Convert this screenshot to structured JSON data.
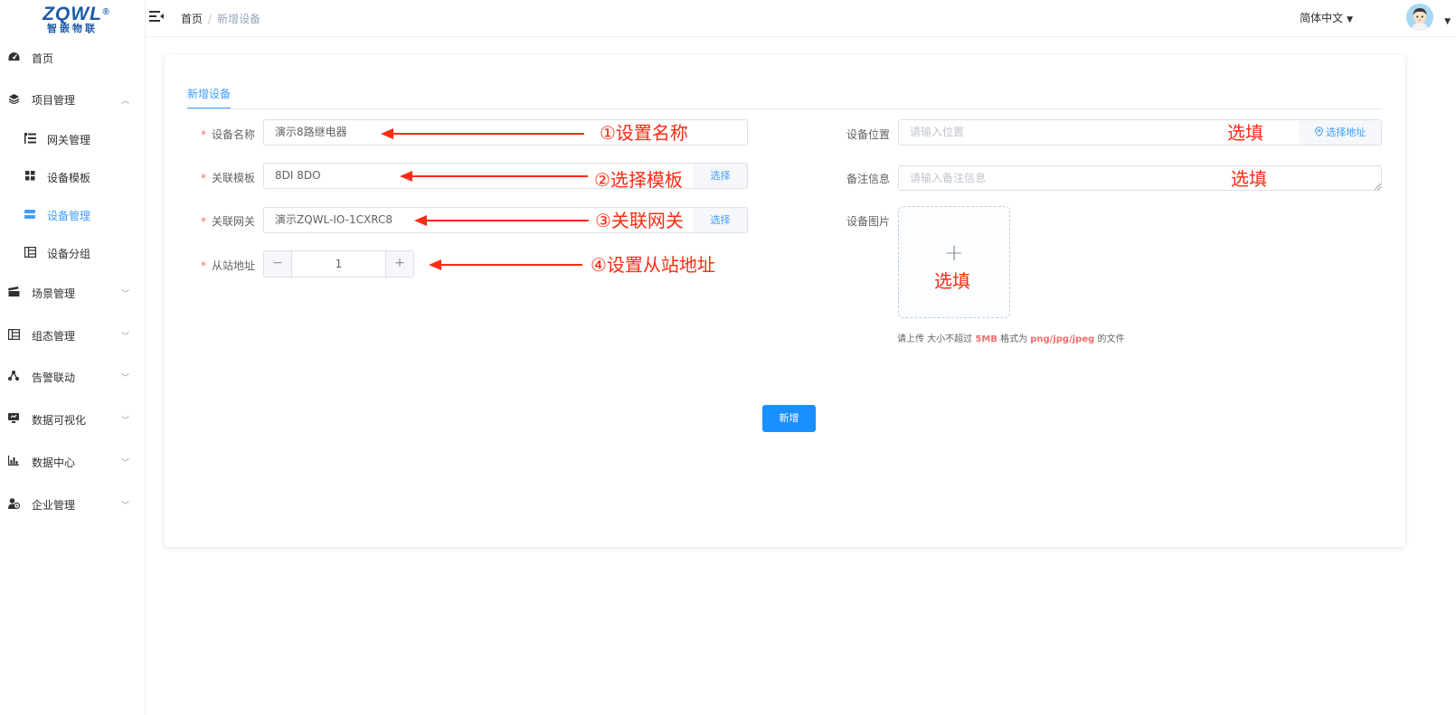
{
  "logo": {
    "top": "ZQWL",
    "reg": "®",
    "bottom": "智嵌物联"
  },
  "sidebar": {
    "items": [
      {
        "label": "首页",
        "icon": "dashboard-icon"
      },
      {
        "label": "项目管理",
        "icon": "layers-icon"
      },
      {
        "label": "网关管理",
        "icon": "tree-list-icon"
      },
      {
        "label": "设备模板",
        "icon": "grid-icon"
      },
      {
        "label": "设备管理",
        "icon": "server-icon"
      },
      {
        "label": "设备分组",
        "icon": "table-icon"
      },
      {
        "label": "场景管理",
        "icon": "clapper-icon"
      },
      {
        "label": "组态管理",
        "icon": "table-icon"
      },
      {
        "label": "告警联动",
        "icon": "share-nodes-icon"
      },
      {
        "label": "数据可视化",
        "icon": "monitor-icon"
      },
      {
        "label": "数据中心",
        "icon": "bar-chart-icon"
      },
      {
        "label": "企业管理",
        "icon": "users-icon"
      }
    ],
    "active": "设备管理"
  },
  "header": {
    "breadcrumb": [
      "首页",
      "新增设备"
    ],
    "separator": "/",
    "language": "简体中文"
  },
  "form": {
    "tab": "新增设备",
    "required_mark": "*",
    "device_name": {
      "label": "设备名称",
      "value": "演示8路继电器"
    },
    "template": {
      "label": "关联模板",
      "value": "8DI 8DO",
      "button": "选择"
    },
    "gateway": {
      "label": "关联网关",
      "value": "演示ZQWL-IO-1CXRC8",
      "button": "选择"
    },
    "slave_address": {
      "label": "从站地址",
      "value": "1",
      "minus": "−",
      "plus": "+"
    },
    "location": {
      "label": "设备位置",
      "placeholder": "请输入位置",
      "button": "选择地址"
    },
    "remark": {
      "label": "备注信息",
      "placeholder": "请输入备注信息"
    },
    "image": {
      "label": "设备图片",
      "plus": "+"
    },
    "hint": {
      "prefix": "请上传 大小不超过 ",
      "size": "5MB",
      "mid": " 格式为 ",
      "formats": "png/jpg/jpeg",
      "suffix": " 的文件"
    },
    "submit": "新增"
  },
  "annotations": {
    "a1": "①设置名称",
    "a2": "②选择模板",
    "a3": "③关联网关",
    "a4": "④设置从站地址",
    "location": "选填",
    "remark": "选填",
    "image": "选填"
  },
  "colors": {
    "primary": "#409eff",
    "button": "#1890ff",
    "annotation": "#ff2a12",
    "required": "#f56c6c"
  }
}
